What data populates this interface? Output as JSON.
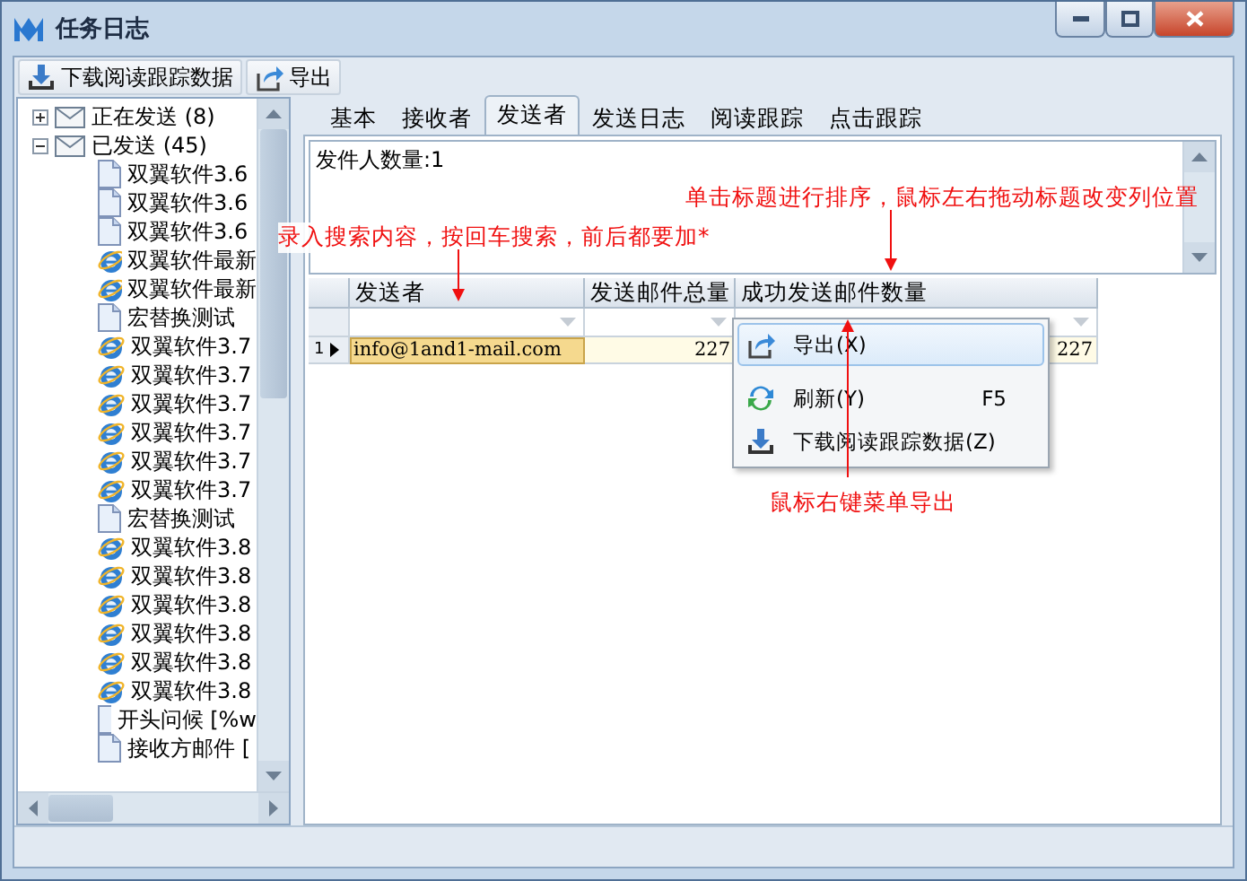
{
  "window": {
    "title": "任务日志"
  },
  "toolbar": [
    {
      "label": "下载阅读跟踪数据",
      "kind": "download"
    },
    {
      "label": "导出",
      "kind": "export"
    }
  ],
  "tree": [
    {
      "label": "正在发送 (8)",
      "kind": "folder",
      "expanded": false
    },
    {
      "label": "已发送 (45)",
      "kind": "folder",
      "expanded": true,
      "children": [
        {
          "label": "双翼软件3.6",
          "kind": "doc"
        },
        {
          "label": "双翼软件3.6",
          "kind": "doc"
        },
        {
          "label": "双翼软件3.6",
          "kind": "doc"
        },
        {
          "label": "双翼软件最新",
          "kind": "web"
        },
        {
          "label": "双翼软件最新",
          "kind": "web"
        },
        {
          "label": "宏替换测试",
          "kind": "doc"
        },
        {
          "label": "双翼软件3.7",
          "kind": "web"
        },
        {
          "label": "双翼软件3.7",
          "kind": "web"
        },
        {
          "label": "双翼软件3.7",
          "kind": "web"
        },
        {
          "label": "双翼软件3.7",
          "kind": "web"
        },
        {
          "label": "双翼软件3.7",
          "kind": "web"
        },
        {
          "label": "双翼软件3.7",
          "kind": "web"
        },
        {
          "label": "宏替换测试",
          "kind": "doc"
        },
        {
          "label": "双翼软件3.8",
          "kind": "web"
        },
        {
          "label": "双翼软件3.8",
          "kind": "web"
        },
        {
          "label": "双翼软件3.8",
          "kind": "web"
        },
        {
          "label": "双翼软件3.8",
          "kind": "web"
        },
        {
          "label": "双翼软件3.8",
          "kind": "web"
        },
        {
          "label": "双翼软件3.8",
          "kind": "web"
        },
        {
          "label": "开头问候 [%w",
          "kind": "doc"
        },
        {
          "label": "接收方邮件 [",
          "kind": "doc"
        }
      ]
    }
  ],
  "tabs": [
    {
      "label": "基本",
      "selected": false
    },
    {
      "label": "接收者",
      "selected": false
    },
    {
      "label": "发送者",
      "selected": true
    },
    {
      "label": "发送日志",
      "selected": false
    },
    {
      "label": "阅读跟踪",
      "selected": false
    },
    {
      "label": "点击跟踪",
      "selected": false
    }
  ],
  "summary": "发件人数量:1",
  "grid": {
    "columns": [
      "发送者",
      "发送邮件总量",
      "成功发送邮件数量"
    ],
    "rows": [
      {
        "index": "1",
        "cells": [
          "info@1and1-mail.com",
          "227",
          "227"
        ],
        "selected": true
      }
    ]
  },
  "context_menu": [
    {
      "label": "导出(X)",
      "kind": "export",
      "highlighted": true
    },
    {
      "label": "刷新(Y)",
      "shortcut": "F5",
      "kind": "refresh",
      "highlighted": false
    },
    {
      "label": "下载阅读跟踪数据(Z)",
      "kind": "download",
      "highlighted": false
    }
  ],
  "annotations": [
    "录入搜索内容，按回车搜索，前后都要加*",
    "单击标题进行排序，鼠标左右拖动标题改变列位置",
    "鼠标右键菜单导出"
  ]
}
